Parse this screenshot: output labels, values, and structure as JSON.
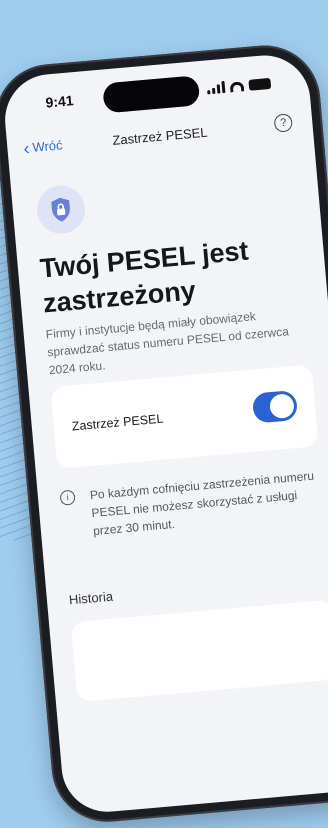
{
  "status_bar": {
    "time": "9:41"
  },
  "nav": {
    "back_label": "Wróć",
    "title": "Zastrzeż PESEL",
    "help_symbol": "?"
  },
  "hero": {
    "icon": "shield-lock-icon",
    "title": "Twój PESEL jest zastrzeżony",
    "description": "Firmy i instytucje będą miały obowiązek sprawdzać status numeru PESEL od czerwca 2024 roku."
  },
  "toggle_card": {
    "label": "Zastrzeż PESEL",
    "enabled": true
  },
  "info": {
    "icon_symbol": "i",
    "text": "Po każdym cofnięciu zastrzeżenia numeru PESEL nie możesz skorzystać z usługi przez 30 minut."
  },
  "history": {
    "section_title": "Historia"
  },
  "colors": {
    "accent": "#2b62d2",
    "background": "#9fcdf0",
    "screen": "#f3f4f8"
  }
}
